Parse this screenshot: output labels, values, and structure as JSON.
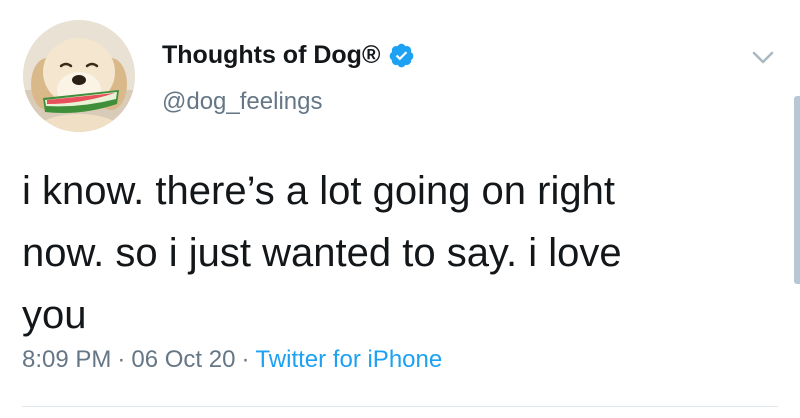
{
  "tweet": {
    "author": {
      "display_name": "Thoughts of Dog®",
      "handle": "@dog_feelings",
      "verified": true,
      "avatar_icon": "dog-with-watermelon-avatar"
    },
    "text": "i know. there’s a lot going on right\nnow. so i just wanted to say. i love\nyou",
    "meta": {
      "time": "8:09 PM",
      "separator": "·",
      "date": "06 Oct 20",
      "source": "Twitter for iPhone"
    },
    "menu_icon": "chevron-down-icon"
  },
  "colors": {
    "text_primary": "#14171a",
    "text_secondary": "#657786",
    "accent": "#1da1f2",
    "divider": "#e1e8ed"
  }
}
